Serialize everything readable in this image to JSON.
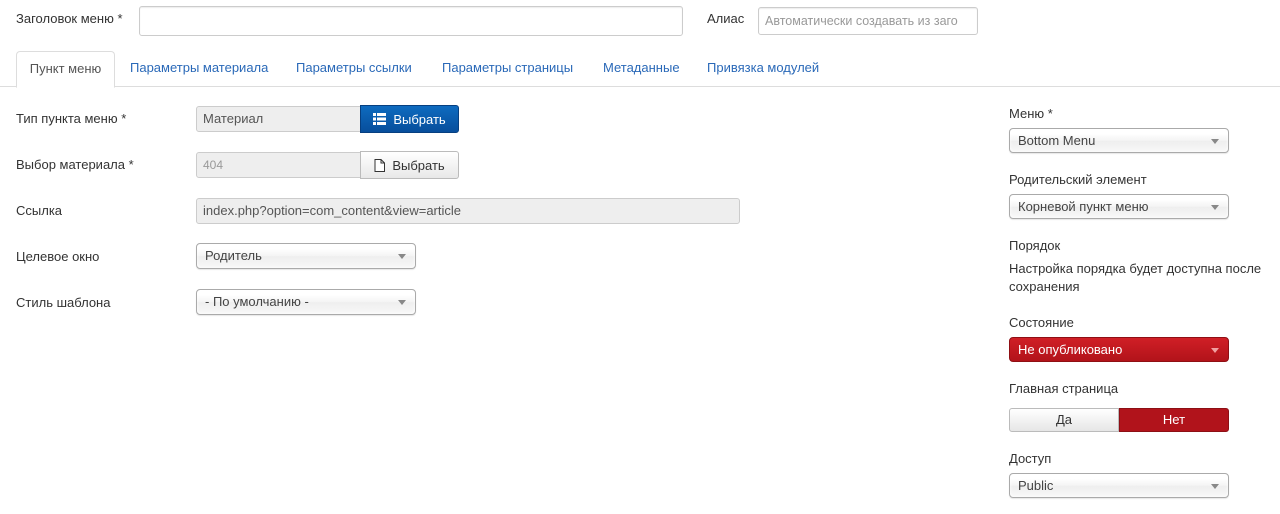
{
  "header": {
    "title_label": "Заголовок меню *",
    "title_value": "",
    "alias_label": "Алиас",
    "alias_placeholder": "Автоматически создавать из заго"
  },
  "tabs": [
    {
      "label": "Пункт меню",
      "active": true
    },
    {
      "label": "Параметры материала",
      "active": false
    },
    {
      "label": "Параметры ссылки",
      "active": false
    },
    {
      "label": "Параметры страницы",
      "active": false
    },
    {
      "label": "Метаданные",
      "active": false
    },
    {
      "label": "Привязка модулей",
      "active": false
    }
  ],
  "form": {
    "menu_item_type": {
      "label": "Тип пункта меню *",
      "value": "Материал",
      "button": "Выбрать",
      "icon": "list-icon"
    },
    "article_select": {
      "label": "Выбор материала *",
      "value": "404",
      "button": "Выбрать",
      "icon": "file-icon"
    },
    "link": {
      "label": "Ссылка",
      "value": "index.php?option=com_content&view=article"
    },
    "target_window": {
      "label": "Целевое окно",
      "value": "Родитель"
    },
    "template_style": {
      "label": "Стиль шаблона",
      "value": "- По умолчанию -"
    }
  },
  "sidebar": {
    "menu": {
      "label": "Меню *",
      "value": "Bottom Menu"
    },
    "parent": {
      "label": "Родительский элемент",
      "value": "Корневой пункт меню"
    },
    "ordering": {
      "label": "Порядок",
      "note_line1": "Настройка порядка будет доступна после",
      "note_line2": "сохранения"
    },
    "state": {
      "label": "Состояние",
      "value": "Не опубликовано",
      "color": "#c41920"
    },
    "home": {
      "label": "Главная страница",
      "yes": "Да",
      "no": "Нет",
      "selected": "no"
    },
    "access": {
      "label": "Доступ",
      "value": "Public"
    }
  }
}
